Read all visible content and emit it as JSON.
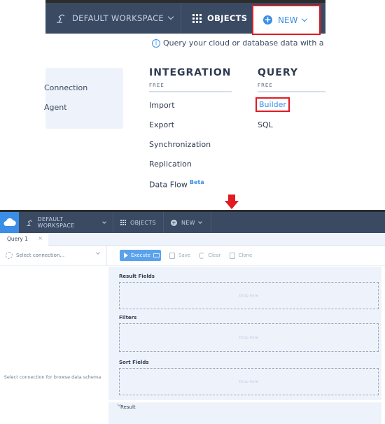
{
  "top": {
    "nav": {
      "workspace_label": "DEFAULT WORKSPACE",
      "objects_label": "OBJECTS",
      "new_label": "NEW"
    },
    "info_text": "Query your cloud or database data with a powerf",
    "left_card": {
      "items": [
        "Connection",
        "Agent"
      ]
    },
    "integration": {
      "heading": "INTEGRATION",
      "tier": "FREE",
      "links": [
        "Import",
        "Export",
        "Synchronization",
        "Replication",
        "Data Flow"
      ],
      "beta_badge": "Beta"
    },
    "query": {
      "heading": "QUERY",
      "tier": "FREE",
      "links": [
        "Builder",
        "SQL"
      ]
    },
    "highlight_color": "#e11b22",
    "accent_color": "#3a8ee6"
  },
  "app": {
    "nav": {
      "workspace_label": "DEFAULT WORKSPACE",
      "objects_label": "OBJECTS",
      "new_label": "NEW"
    },
    "tabs": [
      {
        "label": "Query 1",
        "close": "×"
      }
    ],
    "toolbar": {
      "connection_placeholder": "Select connection...",
      "execute_label": "Execute",
      "save_label": "Save",
      "clear_label": "Clear",
      "clone_label": "Clone"
    },
    "schema_message": "Select connection for browse data schema",
    "sections": [
      {
        "label": "Result Fields",
        "drop_text": "Drop here"
      },
      {
        "label": "Filters",
        "drop_text": "Drop here"
      },
      {
        "label": "Sort Fields",
        "drop_text": "Drop here"
      }
    ],
    "resize_handle": "...",
    "result_label": "Result"
  }
}
